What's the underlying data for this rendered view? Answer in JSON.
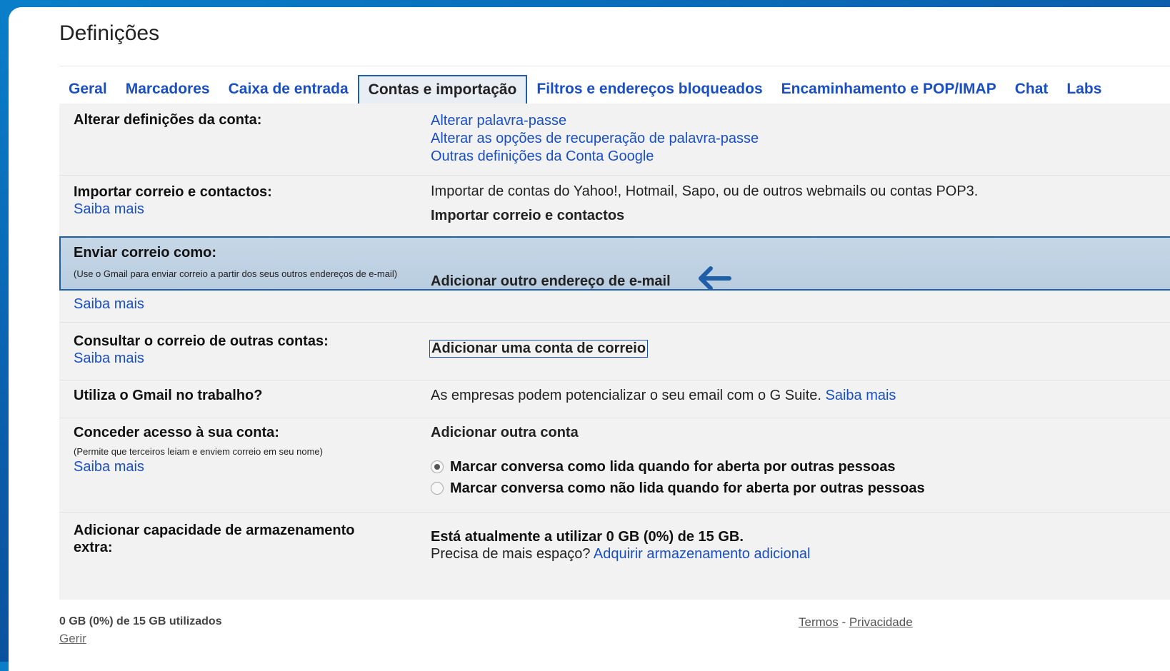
{
  "page_title": "Definições",
  "tabs": [
    {
      "label": "Geral"
    },
    {
      "label": "Marcadores"
    },
    {
      "label": "Caixa de entrada"
    },
    {
      "label": "Contas e importação",
      "active": true
    },
    {
      "label": "Filtros e endereços bloqueados"
    },
    {
      "label": "Encaminhamento e POP/IMAP"
    },
    {
      "label": "Chat"
    },
    {
      "label": "Labs"
    }
  ],
  "rows": {
    "account": {
      "label": "Alterar definições da conta:",
      "links": [
        "Alterar palavra-passe",
        "Alterar as opções de recuperação de palavra-passe",
        "Outras definições da Conta Google"
      ]
    },
    "import": {
      "label": "Importar correio e contactos:",
      "learn_more": "Saiba mais",
      "description": "Importar de contas do Yahoo!, Hotmail, Sapo, ou de outros webmails ou contas POP3.",
      "action": "Importar correio e contactos"
    },
    "send_as": {
      "label": "Enviar correio como:",
      "note": "(Use o Gmail para enviar correio a partir dos seus outros endereços de e-mail)",
      "learn_more": "Saiba mais",
      "action": "Adicionar outro endereço de e-mail"
    },
    "check_mail": {
      "label": "Consultar o correio de outras contas:",
      "learn_more": "Saiba mais",
      "action": "Adicionar uma conta de correio"
    },
    "work": {
      "label": "Utiliza o Gmail no trabalho?",
      "text": "As empresas podem potencializar o seu email com o G Suite.",
      "learn_more": "Saiba mais"
    },
    "grant": {
      "label": "Conceder acesso à sua conta:",
      "note": "(Permite que terceiros leiam e enviem correio em seu nome)",
      "learn_more": "Saiba mais",
      "action": "Adicionar outra conta",
      "options": [
        {
          "label": "Marcar conversa como lida quando for aberta por outras pessoas",
          "selected": true
        },
        {
          "label": "Marcar conversa como não lida quando for aberta por outras pessoas",
          "selected": false
        }
      ]
    },
    "storage": {
      "label": "Adicionar capacidade de armazenamento extra:",
      "usage": "Está atualmente a utilizar 0 GB (0%) de 15 GB.",
      "question": "Precisa de mais espaço?",
      "action": "Adquirir armazenamento adicional"
    }
  },
  "footer": {
    "usage": "0 GB (0%) de 15 GB utilizados",
    "manage": "Gerir",
    "terms": "Termos",
    "separator": " - ",
    "privacy": "Privacidade"
  },
  "colors": {
    "link": "#1a4fc4",
    "accent": "#1f5fa8",
    "highlight": "#c6d7e6"
  },
  "icons": {
    "arrow": "arrow-left-icon"
  }
}
